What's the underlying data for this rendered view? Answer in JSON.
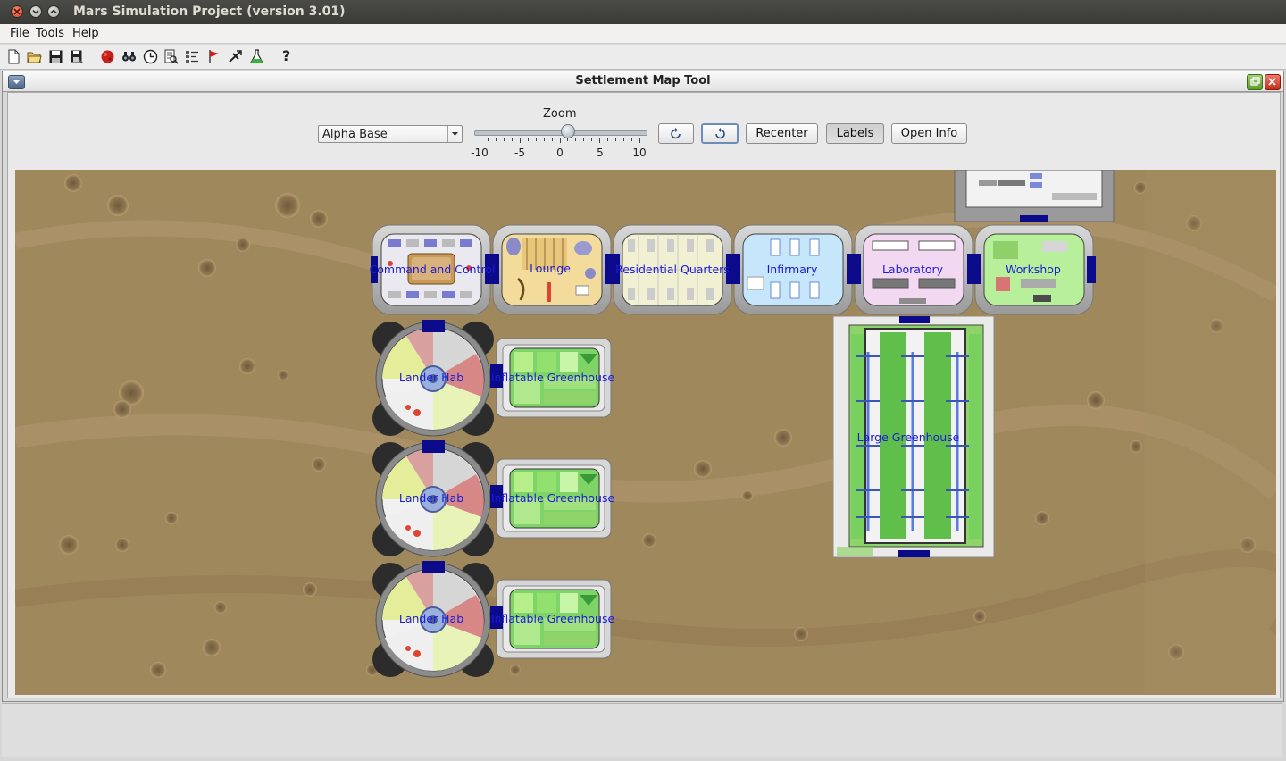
{
  "window": {
    "title": "Mars Simulation Project (version 3.01)"
  },
  "menubar": {
    "items": [
      "File",
      "Tools",
      "Help"
    ]
  },
  "toolbar": {
    "icons": [
      "new-icon",
      "open-icon",
      "save-icon",
      "save-as-icon",
      "mars-navigator-icon",
      "search-icon",
      "time-tool-icon",
      "monitor-tool-icon",
      "mission-tool-icon",
      "science-tool-icon",
      "resupply-tool-icon",
      "settlement-map-tool-icon",
      "help-icon"
    ],
    "help_glyph": "?"
  },
  "frame": {
    "title": "Settlement Map Tool"
  },
  "controls": {
    "settlement_selected": "Alpha Base",
    "zoom_label": "Zoom",
    "zoom_value": 1,
    "zoom_min": -10,
    "zoom_max": 10,
    "tick_labels": [
      "-10",
      "-5",
      "0",
      "5",
      "10"
    ],
    "recenter_label": "Recenter",
    "labels_label": "Labels",
    "open_info_label": "Open Info"
  },
  "map": {
    "buildings": [
      "Command and Control",
      "Lounge",
      "Residential Quarters",
      "Infirmary",
      "Laboratory",
      "Workshop",
      "Lander Hab",
      "Inflatable Greenhouse",
      "Lander Hab",
      "Inflatable Greenhouse",
      "Lander Hab",
      "Inflatable Greenhouse",
      "Large Greenhouse"
    ]
  }
}
